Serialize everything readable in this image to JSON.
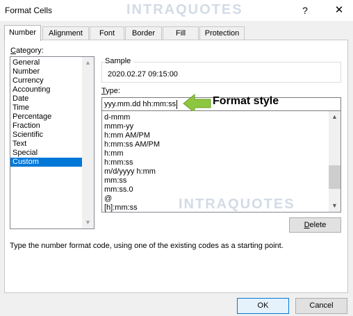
{
  "window": {
    "title": "Format Cells",
    "watermark": "INTRAQUOTES",
    "help_label": "?",
    "close_label": "✕"
  },
  "tabs": [
    {
      "label": "Number",
      "active": true
    },
    {
      "label": "Alignment",
      "active": false
    },
    {
      "label": "Font",
      "active": false
    },
    {
      "label": "Border",
      "active": false
    },
    {
      "label": "Fill",
      "active": false
    },
    {
      "label": "Protection",
      "active": false
    }
  ],
  "category": {
    "label_accel": "C",
    "label_rest": "ategory:",
    "items": [
      "General",
      "Number",
      "Currency",
      "Accounting",
      "Date",
      "Time",
      "Percentage",
      "Fraction",
      "Scientific",
      "Text",
      "Special",
      "Custom"
    ],
    "selected": "Custom"
  },
  "sample": {
    "label": "Sample",
    "value": "2020.02.27 09:15:00"
  },
  "type": {
    "label_accel": "T",
    "label_rest": "ype:",
    "value": "yyy.mm.dd hh:mm:ss"
  },
  "callout": {
    "text": "Format style",
    "arrow_color": "#8dc63f"
  },
  "format_list": [
    "d-mmm",
    "mmm-yy",
    "h:mm AM/PM",
    "h:mm:ss AM/PM",
    "h:mm",
    "h:mm:ss",
    "m/d/yyyy h:mm",
    "mm:ss",
    "mm:ss.0",
    "@",
    "[h]:mm:ss"
  ],
  "buttons": {
    "delete_accel": "D",
    "delete_rest": "elete",
    "ok": "OK",
    "cancel": "Cancel"
  },
  "hint": "Type the number format code, using one of the existing codes as a starting point.",
  "colors": {
    "selection": "#0078d7",
    "dialog_bg": "#f0f0f0"
  }
}
